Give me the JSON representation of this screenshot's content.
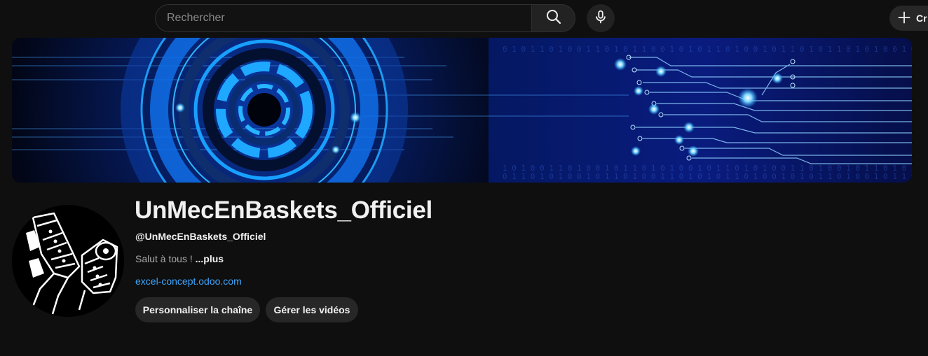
{
  "header": {
    "search_placeholder": "Rechercher",
    "create_label": "Cr"
  },
  "channel": {
    "name": "UnMecEnBaskets_Officiel",
    "handle": "@UnMecEnBaskets_Officiel",
    "description": "Salut à tous ! ",
    "more_label": "...plus",
    "link": "excel-concept.odoo.com"
  },
  "actions": {
    "customize_label": "Personnaliser la chaîne",
    "manage_videos_label": "Gérer les vidéos"
  },
  "colors": {
    "background": "#0f0f0f",
    "link": "#3ea6ff",
    "button_bg": "#272727",
    "banner_accent": "#1ea8ff"
  },
  "icons": [
    "search-icon",
    "mic-icon",
    "plus-icon"
  ]
}
